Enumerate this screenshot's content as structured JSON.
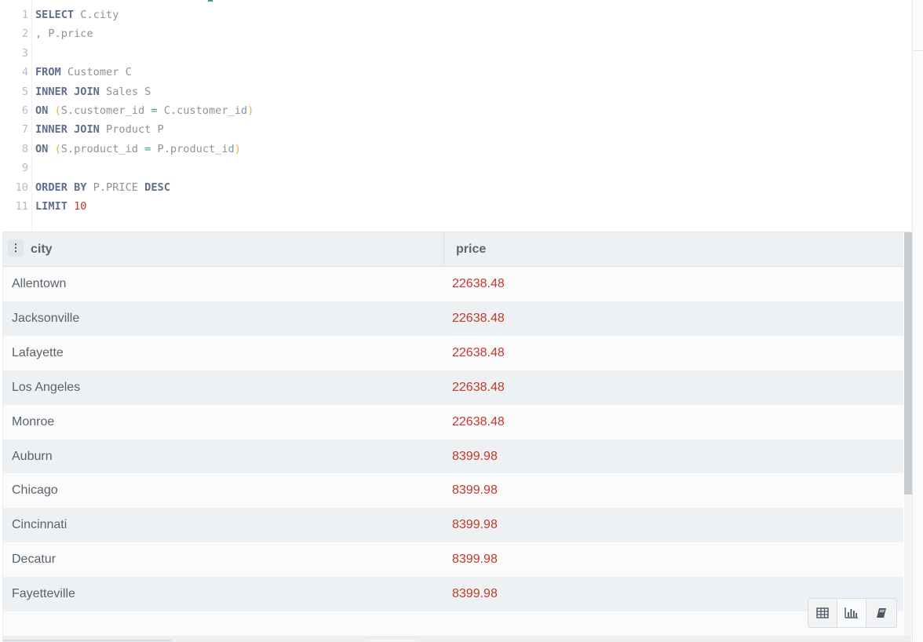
{
  "editor": {
    "lines": [
      {
        "n": "1",
        "parts": [
          {
            "t": "SELECT",
            "c": "kw"
          },
          {
            "t": " C.city",
            "c": ""
          }
        ]
      },
      {
        "n": "2",
        "parts": [
          {
            "t": ", P.price",
            "c": ""
          }
        ]
      },
      {
        "n": "3",
        "parts": []
      },
      {
        "n": "4",
        "parts": [
          {
            "t": "FROM",
            "c": "kw"
          },
          {
            "t": " Customer C",
            "c": ""
          }
        ]
      },
      {
        "n": "5",
        "parts": [
          {
            "t": "INNER JOIN",
            "c": "kw"
          },
          {
            "t": " Sales S",
            "c": ""
          }
        ]
      },
      {
        "n": "6",
        "parts": [
          {
            "t": "ON",
            "c": "kw"
          },
          {
            "t": " ",
            "c": ""
          },
          {
            "t": "(",
            "c": "par"
          },
          {
            "t": "S.customer_id ",
            "c": ""
          },
          {
            "t": "=",
            "c": "op"
          },
          {
            "t": " C.customer_id",
            "c": ""
          },
          {
            "t": ")",
            "c": "par"
          }
        ]
      },
      {
        "n": "7",
        "parts": [
          {
            "t": "INNER JOIN",
            "c": "kw"
          },
          {
            "t": " Product P",
            "c": ""
          }
        ]
      },
      {
        "n": "8",
        "parts": [
          {
            "t": "ON",
            "c": "kw"
          },
          {
            "t": " ",
            "c": ""
          },
          {
            "t": "(",
            "c": "par"
          },
          {
            "t": "S.product_id ",
            "c": ""
          },
          {
            "t": "=",
            "c": "op"
          },
          {
            "t": " P.product_id",
            "c": ""
          },
          {
            "t": ")",
            "c": "par"
          }
        ]
      },
      {
        "n": "9",
        "parts": []
      },
      {
        "n": "10",
        "parts": [
          {
            "t": "ORDER BY",
            "c": "kw"
          },
          {
            "t": " P.PRICE ",
            "c": ""
          },
          {
            "t": "DESC",
            "c": "kw"
          }
        ]
      },
      {
        "n": "11",
        "parts": [
          {
            "t": "LIMIT",
            "c": "kw"
          },
          {
            "t": " ",
            "c": ""
          },
          {
            "t": "10",
            "c": "num"
          }
        ]
      }
    ]
  },
  "results": {
    "handle_glyph": "⋮",
    "columns": {
      "city": "city",
      "price": "price"
    },
    "rows": [
      {
        "city": "Allentown",
        "price": "22638.48"
      },
      {
        "city": "Jacksonville",
        "price": "22638.48"
      },
      {
        "city": "Lafayette",
        "price": "22638.48"
      },
      {
        "city": "Los Angeles",
        "price": "22638.48"
      },
      {
        "city": "Monroe",
        "price": "22638.48"
      },
      {
        "city": "Auburn",
        "price": "8399.98"
      },
      {
        "city": "Chicago",
        "price": "8399.98"
      },
      {
        "city": "Cincinnati",
        "price": "8399.98"
      },
      {
        "city": "Decatur",
        "price": "8399.98"
      },
      {
        "city": "Fayetteville",
        "price": "8399.98"
      }
    ]
  },
  "view_switch": {
    "buttons": [
      {
        "name": "table-view-button",
        "icon": "table-icon",
        "active": false
      },
      {
        "name": "chart-view-button",
        "icon": "bar-chart-icon",
        "active": true
      },
      {
        "name": "notebook-view-button",
        "icon": "notebook-icon",
        "active": false
      }
    ]
  },
  "colors": {
    "keyword": "#5d6f8d",
    "price_text": "#c0392b",
    "row_alt": "#eef1f3"
  }
}
